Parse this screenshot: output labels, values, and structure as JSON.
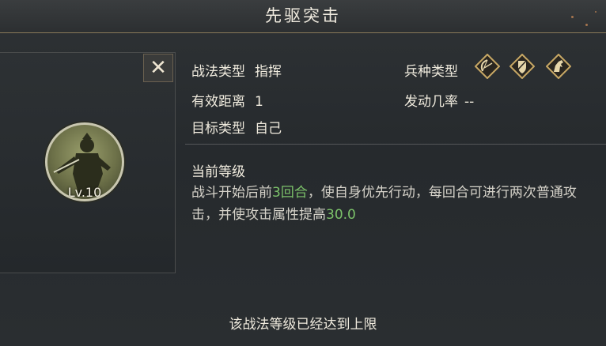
{
  "title": "先驱突击",
  "close_label": "✕",
  "skill": {
    "level_label": "Lv.10",
    "fields": {
      "tactic_type_label": "战法类型",
      "tactic_type_value": "指挥",
      "range_label": "有效距离",
      "range_value": "1",
      "target_label": "目标类型",
      "target_value": "自己",
      "troop_type_label": "兵种类型",
      "trigger_rate_label": "发动几率",
      "trigger_rate_value": "--"
    },
    "troop_icons": [
      "bow-icon",
      "shield-icon",
      "cavalry-icon"
    ],
    "current_level_title": "当前等级",
    "description": {
      "part1": "战斗开始后前",
      "hl1": "3回合",
      "part2": "，使自身优先行动，每回合可进行两次普通攻击，并使攻击属性提高",
      "hl2": "30.0"
    }
  },
  "bottom_message": "该战法等级已经达到上限",
  "colors": {
    "highlight": "#7cc26a",
    "gold_border": "#c8a865",
    "background": "#272b2e"
  }
}
